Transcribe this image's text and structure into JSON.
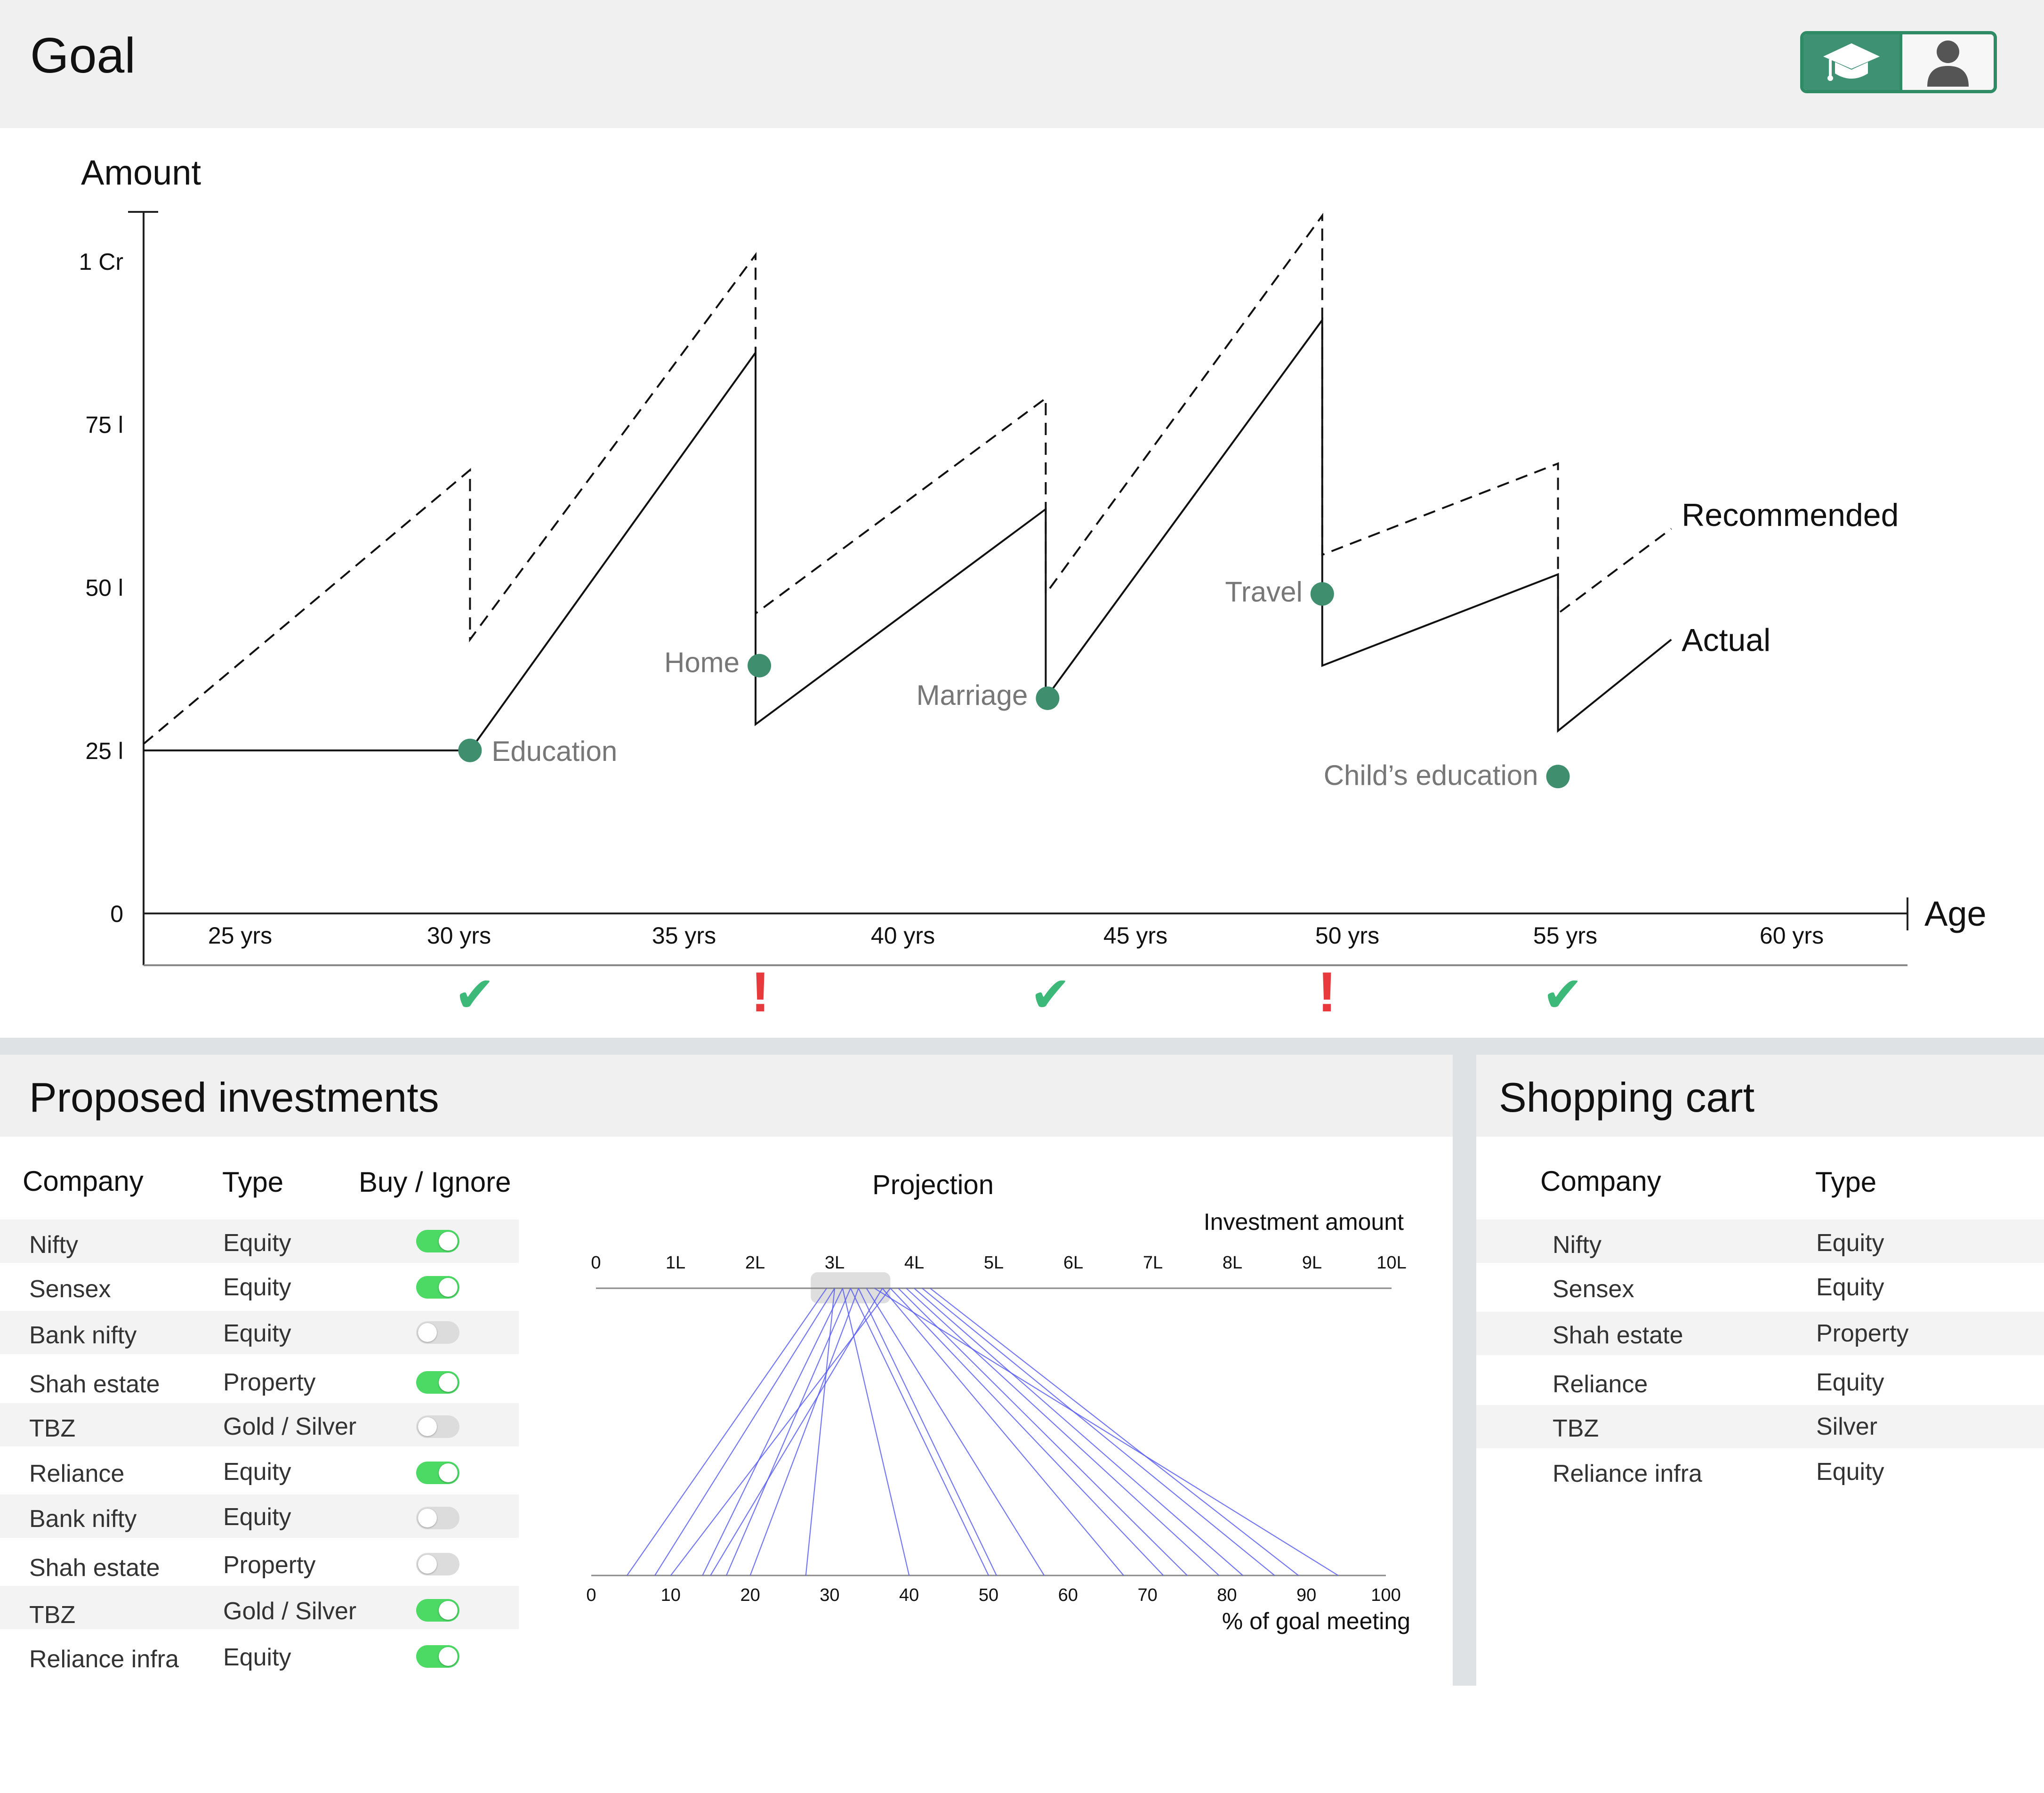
{
  "header": {
    "title": "Goal"
  },
  "icons": {
    "education": "graduation-cap-icon",
    "profile": "person-icon"
  },
  "colors": {
    "accent": "#3f9173",
    "dot": "#3f8f6f",
    "check": "#3cb878",
    "alert": "#e8393c",
    "toggle_on": "#4cd964",
    "projection_line": "#5b5ef0"
  },
  "chart_data": {
    "type": "line",
    "ylabel": "Amount",
    "xlabel": "Age",
    "y_ticks": [
      "1 Cr",
      "75 l",
      "50 l",
      "25 l",
      "0"
    ],
    "x_ticks": [
      "25 yrs",
      "30 yrs",
      "35 yrs",
      "40 yrs",
      "45 yrs",
      "50 yrs",
      "55 yrs",
      "60 yrs"
    ],
    "series": [
      {
        "name": "Recommended",
        "style": "dashed",
        "points": [
          [
            22.8,
            26
          ],
          [
            30,
            68
          ],
          [
            30,
            42
          ],
          [
            36.3,
            101
          ],
          [
            36.3,
            46
          ],
          [
            42.7,
            79
          ],
          [
            42.7,
            49
          ],
          [
            48.8,
            107
          ],
          [
            48.8,
            55
          ],
          [
            54,
            69
          ],
          [
            54,
            46
          ],
          [
            56.5,
            59
          ]
        ]
      },
      {
        "name": "Actual",
        "style": "solid",
        "points": [
          [
            22.8,
            25
          ],
          [
            30,
            25
          ],
          [
            36.3,
            86
          ],
          [
            36.3,
            29
          ],
          [
            42.7,
            62
          ],
          [
            42.7,
            33
          ],
          [
            48.8,
            91
          ],
          [
            48.8,
            38
          ],
          [
            54,
            52
          ],
          [
            54,
            28
          ],
          [
            56.5,
            42
          ]
        ]
      }
    ],
    "goals": [
      {
        "label": "Education",
        "age": 30,
        "amount": 25,
        "status": "met"
      },
      {
        "label": "Home",
        "age": 36.3,
        "amount": 38,
        "status": "warning"
      },
      {
        "label": "Marriage",
        "age": 42.7,
        "amount": 33,
        "status": "met"
      },
      {
        "label": "Travel",
        "age": 48.8,
        "amount": 49,
        "status": "warning"
      },
      {
        "label": "Child’s education",
        "age": 54,
        "amount": 21,
        "status": "met"
      }
    ],
    "status_marks": [
      {
        "status": "met",
        "glyph": "✔"
      },
      {
        "status": "warning",
        "glyph": "!"
      },
      {
        "status": "met",
        "glyph": "✔"
      },
      {
        "status": "warning",
        "glyph": "!"
      },
      {
        "status": "met",
        "glyph": "✔"
      }
    ]
  },
  "proposed": {
    "title": "Proposed investments",
    "columns": {
      "company": "Company",
      "type": "Type",
      "buy": "Buy / Ignore"
    },
    "rows": [
      {
        "company": "Nifty",
        "type": "Equity",
        "buy": true
      },
      {
        "company": "Sensex",
        "type": "Equity",
        "buy": true
      },
      {
        "company": "Bank nifty",
        "type": "Equity",
        "buy": false
      },
      {
        "company": "Shah estate",
        "type": "Property",
        "buy": true
      },
      {
        "company": "TBZ",
        "type": "Gold / Silver",
        "buy": false
      },
      {
        "company": "Reliance",
        "type": "Equity",
        "buy": true
      },
      {
        "company": "Bank nifty",
        "type": "Equity",
        "buy": false
      },
      {
        "company": "Shah estate",
        "type": "Property",
        "buy": false
      },
      {
        "company": "TBZ",
        "type": "Gold / Silver",
        "buy": true
      },
      {
        "company": "Reliance infra",
        "type": "Equity",
        "buy": true
      }
    ]
  },
  "projection": {
    "title": "Projection",
    "top_axis_label": "Investment amount",
    "top_ticks": [
      "0",
      "1L",
      "2L",
      "3L",
      "4L",
      "5L",
      "6L",
      "7L",
      "8L",
      "9L",
      "10L"
    ],
    "bottom_axis_label": "% of goal meeting",
    "bottom_ticks": [
      "0",
      "10",
      "20",
      "30",
      "40",
      "50",
      "60",
      "70",
      "80",
      "90",
      "100"
    ],
    "selected_range": [
      2.7,
      3.7
    ],
    "lines": [
      [
        2.9,
        4.5
      ],
      [
        3.0,
        8
      ],
      [
        3.1,
        14
      ],
      [
        3.2,
        17
      ],
      [
        3.3,
        20
      ],
      [
        3.0,
        27
      ],
      [
        3.1,
        40
      ],
      [
        3.2,
        50
      ],
      [
        3.3,
        51
      ],
      [
        3.4,
        57
      ],
      [
        3.6,
        67
      ],
      [
        3.7,
        72
      ],
      [
        3.8,
        75
      ],
      [
        3.9,
        79
      ],
      [
        4.0,
        82
      ],
      [
        4.1,
        86
      ],
      [
        4.2,
        89
      ],
      [
        3.5,
        94
      ],
      [
        3.6,
        15
      ],
      [
        3.7,
        10
      ]
    ]
  },
  "cart": {
    "title": "Shopping cart",
    "columns": {
      "company": "Company",
      "type": "Type"
    },
    "rows": [
      {
        "company": "Nifty",
        "type": "Equity"
      },
      {
        "company": "Sensex",
        "type": "Equity"
      },
      {
        "company": "Shah estate",
        "type": "Property"
      },
      {
        "company": "Reliance",
        "type": "Equity"
      },
      {
        "company": "TBZ",
        "type": "Silver"
      },
      {
        "company": "Reliance infra",
        "type": "Equity"
      }
    ]
  }
}
